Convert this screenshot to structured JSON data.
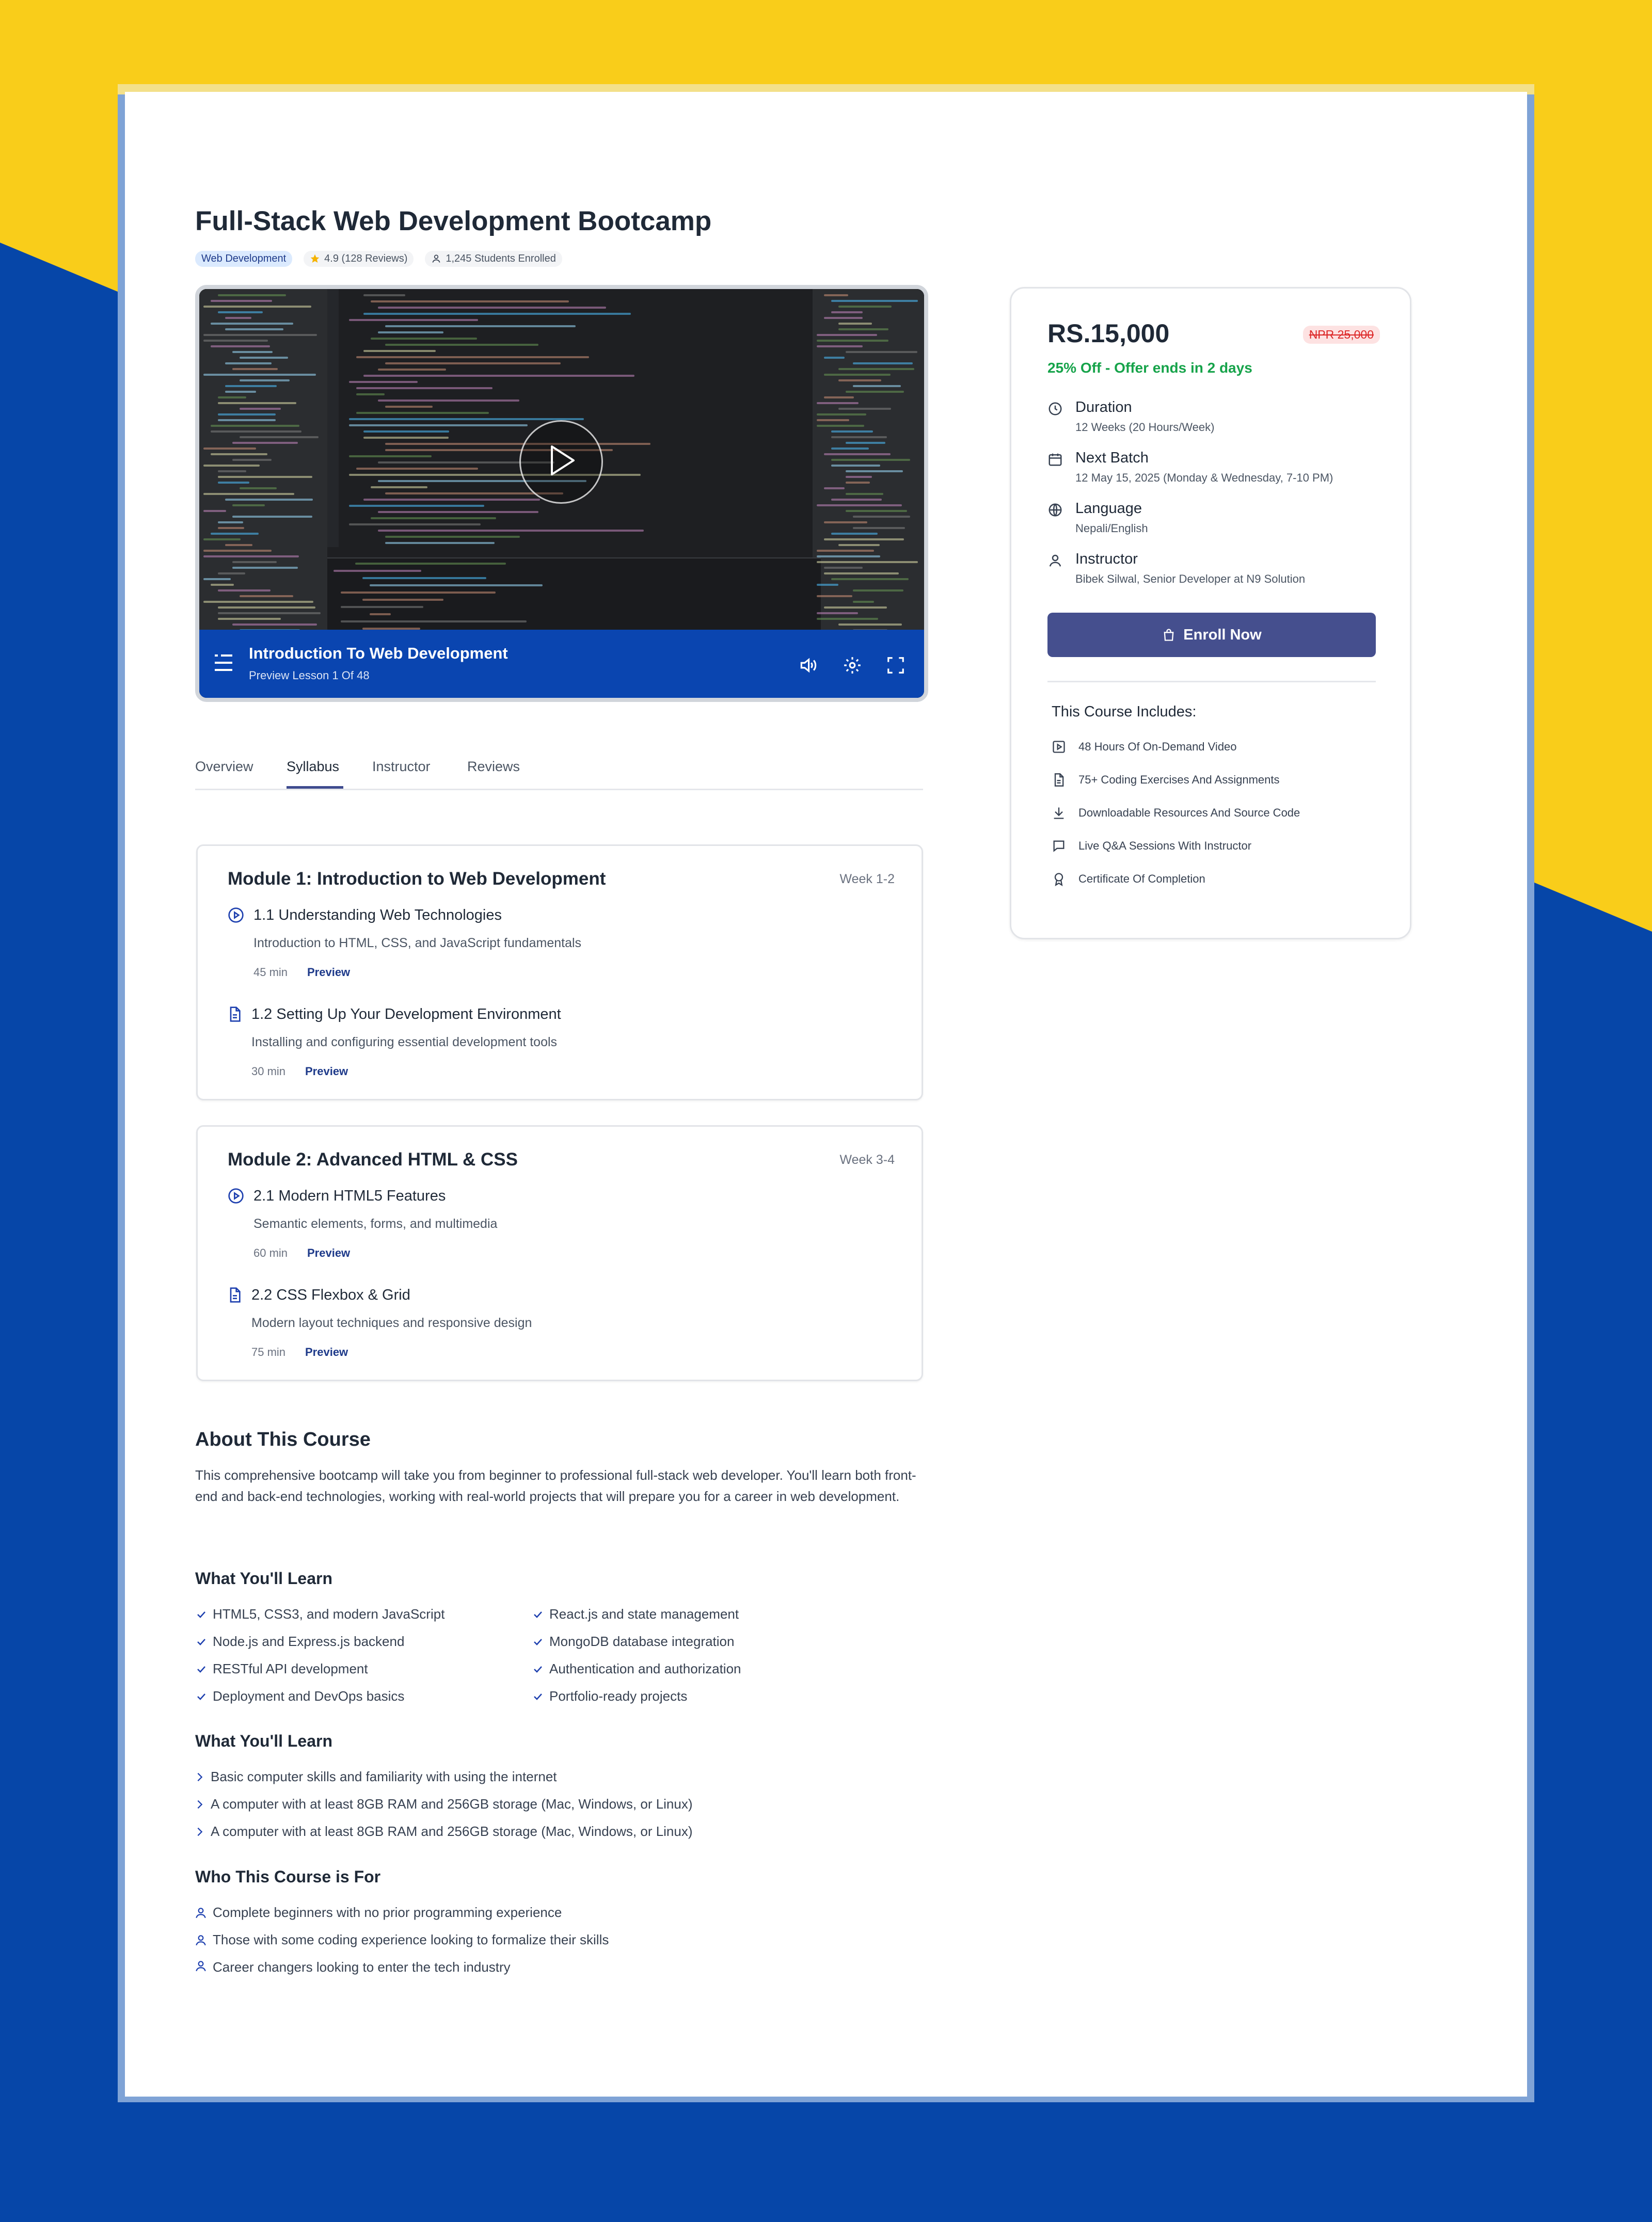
{
  "colors": {
    "accent": "#454f8e",
    "video_bar": "#0a45b0",
    "bg_blue": "#0646a8",
    "bg_yellow": "#f9cd1a",
    "discount": "#16a34a",
    "old_price": "#dc2626"
  },
  "course": {
    "title": "Full-Stack Web Development Bootcamp",
    "category": "Web Development",
    "rating": "4.9 (128 Reviews)",
    "students": "1,245 Students Enrolled"
  },
  "video": {
    "lesson_title": "Introduction To Web Development",
    "lesson_sub": "Preview Lesson 1 Of 48",
    "icons": [
      "menu-icon",
      "play-icon",
      "volume-icon",
      "settings-icon",
      "fullscreen-icon"
    ]
  },
  "tabs": [
    {
      "label": "Overview"
    },
    {
      "label": "Syllabus",
      "active": true
    },
    {
      "label": "Instructor"
    },
    {
      "label": "Reviews"
    }
  ],
  "modules": [
    {
      "title": "Module 1: Introduction to Web Development",
      "week": "Week 1-2",
      "lessons": [
        {
          "title": "1.1 Understanding Web Technologies",
          "desc": "Introduction to HTML, CSS, and JavaScript fundamentals",
          "duration": "45 min",
          "preview": "Preview",
          "icon": "play-circle-icon"
        },
        {
          "title": "1.2 Setting Up Your Development Environment",
          "desc": "Installing and configuring essential development tools",
          "duration": "30 min",
          "preview": "Preview",
          "icon": "document-icon"
        }
      ]
    },
    {
      "title": "Module 2: Advanced HTML & CSS",
      "week": "Week 3-4",
      "lessons": [
        {
          "title": "2.1 Modern HTML5 Features",
          "desc": "Semantic elements, forms, and multimedia",
          "duration": "60 min",
          "preview": "Preview",
          "icon": "play-circle-icon"
        },
        {
          "title": "2.2 CSS Flexbox & Grid",
          "desc": "Modern layout techniques and responsive design",
          "duration": "75 min",
          "preview": "Preview",
          "icon": "document-icon"
        }
      ]
    }
  ],
  "about": {
    "heading": "About This Course",
    "text": "This comprehensive bootcamp will take you from beginner to professional full-stack web developer. You'll learn both front-end and back-end technologies, working with real-world projects that will prepare you for a career in web development."
  },
  "learn": {
    "heading": "What You'll Learn",
    "left": [
      "HTML5, CSS3, and modern JavaScript",
      "Node.js and Express.js backend",
      "RESTful API development",
      "Deployment and DevOps basics"
    ],
    "right": [
      "React.js and state management",
      "MongoDB database integration",
      "Authentication and authorization",
      "Portfolio-ready projects"
    ]
  },
  "requirements": {
    "heading": "What You'll Learn",
    "items": [
      "Basic computer skills and familiarity with using the internet",
      "A computer with at least 8GB RAM and 256GB storage (Mac, Windows, or Linux)",
      "A computer with at least 8GB RAM and 256GB storage (Mac, Windows, or Linux)"
    ]
  },
  "audience": {
    "heading": "Who This Course is For",
    "items": [
      "Complete beginners with no prior programming experience",
      "Those with some coding experience looking to formalize their skills",
      "Career changers looking to enter the tech industry"
    ]
  },
  "sidebar": {
    "price": "RS.15,000",
    "old_price": "NPR 25,000",
    "discount": "25% Off - Offer ends in 2 days",
    "info": [
      {
        "label": "Duration",
        "value": "12 Weeks (20 Hours/Week)",
        "icon": "clock-icon"
      },
      {
        "label": "Next Batch",
        "value": "12 May 15, 2025 (Monday & Wednesday, 7-10 PM)",
        "icon": "calendar-icon"
      },
      {
        "label": "Language",
        "value": "Nepali/English",
        "icon": "globe-icon"
      },
      {
        "label": "Instructor",
        "value": "Bibek Silwal, Senior Developer at N9 Solution",
        "icon": "user-icon"
      }
    ],
    "enroll_label": "Enroll Now",
    "includes_heading": "This Course Includes:",
    "includes": [
      {
        "label": "48 Hours Of On-Demand Video",
        "icon": "video-icon"
      },
      {
        "label": "75+ Coding Exercises And Assignments",
        "icon": "file-icon"
      },
      {
        "label": "Downloadable Resources And Source Code",
        "icon": "download-icon"
      },
      {
        "label": "Live Q&A Sessions With Instructor",
        "icon": "chat-icon"
      },
      {
        "label": "Certificate Of Completion",
        "icon": "award-icon"
      }
    ]
  }
}
